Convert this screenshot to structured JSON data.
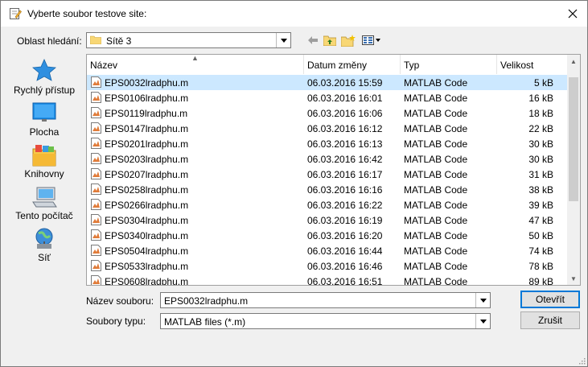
{
  "window": {
    "title": "Vyberte soubor testove site:"
  },
  "lookin": {
    "label": "Oblast hledání:",
    "value": "Sítě 3"
  },
  "places": [
    {
      "label": "Rychlý přístup",
      "icon": "star-icon"
    },
    {
      "label": "Plocha",
      "icon": "desktop-icon"
    },
    {
      "label": "Knihovny",
      "icon": "libraries-icon"
    },
    {
      "label": "Tento počítač",
      "icon": "computer-icon"
    },
    {
      "label": "Síť",
      "icon": "network-icon"
    }
  ],
  "columns": {
    "name": "Název",
    "date": "Datum změny",
    "type": "Typ",
    "size": "Velikost"
  },
  "files": [
    {
      "name": "EPS0032lradphu.m",
      "date": "06.03.2016 15:59",
      "type": "MATLAB Code",
      "size": "5 kB"
    },
    {
      "name": "EPS0106lradphu.m",
      "date": "06.03.2016 16:01",
      "type": "MATLAB Code",
      "size": "16 kB"
    },
    {
      "name": "EPS0119lradphu.m",
      "date": "06.03.2016 16:06",
      "type": "MATLAB Code",
      "size": "18 kB"
    },
    {
      "name": "EPS0147lradphu.m",
      "date": "06.03.2016 16:12",
      "type": "MATLAB Code",
      "size": "22 kB"
    },
    {
      "name": "EPS0201lradphu.m",
      "date": "06.03.2016 16:13",
      "type": "MATLAB Code",
      "size": "30 kB"
    },
    {
      "name": "EPS0203lradphu.m",
      "date": "06.03.2016 16:42",
      "type": "MATLAB Code",
      "size": "30 kB"
    },
    {
      "name": "EPS0207lradphu.m",
      "date": "06.03.2016 16:17",
      "type": "MATLAB Code",
      "size": "31 kB"
    },
    {
      "name": "EPS0258lradphu.m",
      "date": "06.03.2016 16:16",
      "type": "MATLAB Code",
      "size": "38 kB"
    },
    {
      "name": "EPS0266lradphu.m",
      "date": "06.03.2016 16:22",
      "type": "MATLAB Code",
      "size": "39 kB"
    },
    {
      "name": "EPS0304lradphu.m",
      "date": "06.03.2016 16:19",
      "type": "MATLAB Code",
      "size": "47 kB"
    },
    {
      "name": "EPS0340lradphu.m",
      "date": "06.03.2016 16:20",
      "type": "MATLAB Code",
      "size": "50 kB"
    },
    {
      "name": "EPS0504lradphu.m",
      "date": "06.03.2016 16:44",
      "type": "MATLAB Code",
      "size": "74 kB"
    },
    {
      "name": "EPS0533lradphu.m",
      "date": "06.03.2016 16:46",
      "type": "MATLAB Code",
      "size": "78 kB"
    },
    {
      "name": "EPS0608lradphu.m",
      "date": "06.03.2016 16:51",
      "type": "MATLAB Code",
      "size": "89 kB"
    }
  ],
  "filename": {
    "label": "Název souboru:",
    "value": "EPS0032lradphu.m"
  },
  "filetype": {
    "label": "Soubory typu:",
    "value": "MATLAB files (*.m)"
  },
  "buttons": {
    "open": "Otevřít",
    "cancel": "Zrušit"
  },
  "colors": {
    "selection": "#cce8ff",
    "accent": "#0078d7"
  }
}
